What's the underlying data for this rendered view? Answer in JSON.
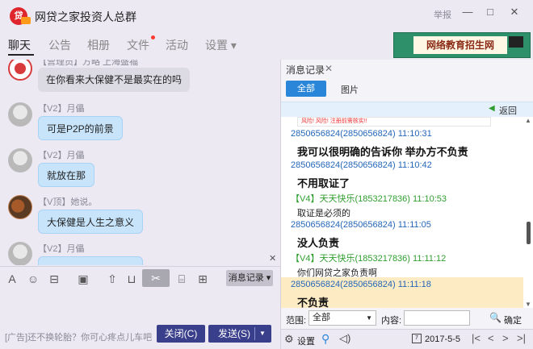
{
  "window": {
    "title": "网贷之家投资人总群",
    "logo_text": "贷",
    "report": "举报",
    "btn_minimize": "—",
    "btn_maximize": "□",
    "btn_close": "✕"
  },
  "tabs": [
    {
      "label": "聊天",
      "active": true
    },
    {
      "label": "公告"
    },
    {
      "label": "相册"
    },
    {
      "label": "文件",
      "has_dot": true
    },
    {
      "label": "活动"
    },
    {
      "label": "设置 ▾"
    }
  ],
  "banner": {
    "text": "网络教育招生网"
  },
  "chat": {
    "messages": [
      {
        "sender": "【营理员】方略 上海盛福",
        "text": "在你看来大保健不是最实在的吗",
        "style": "gray",
        "avatar": "red"
      },
      {
        "sender": "【V2】月儡",
        "text": "可是P2P的前景",
        "style": "blue",
        "avatar": "default"
      },
      {
        "sender": "【V2】月儡",
        "text": "就放在那",
        "style": "blue",
        "avatar": "default"
      },
      {
        "sender": "【V顶】她说。",
        "text": "大保健是人生之意义",
        "style": "blue",
        "avatar": "photo"
      },
      {
        "sender": "【V2】月儡",
        "text": "",
        "style": "blue",
        "avatar": "default"
      }
    ]
  },
  "toolbar": {
    "font_icon": "A",
    "emoji_icon": "☺",
    "gift_icon": "⊟",
    "image_icon": "▣",
    "upload_icon": "⇧",
    "folder_icon": "⊔",
    "scissors_icon": "✂",
    "history_icon": "⌸",
    "mail_icon": "⊞",
    "msg_record": "消息记录 ▾"
  },
  "input": {
    "ad_text": "[广告]还不换轮胎？你可心疼点儿车吧",
    "close_label": "关闭(C)",
    "send_label": "发送(S)",
    "send_arrow": "▼"
  },
  "panel": {
    "tab_label": "消息记录",
    "tab_close": "✕",
    "filter_all": "全部",
    "filter_images": "图片",
    "back": "返回",
    "image_strip": "风险! 风险! 注册前需核实!!",
    "records": [
      {
        "header": "2850656824(2850656824) 11:10:31",
        "header_style": "blue",
        "body": "我可以很明确的告诉你 举办方不负责",
        "body_style": "big"
      },
      {
        "header": "2850656824(2850656824) 11:10:42",
        "header_style": "blue",
        "body": "不用取证了",
        "body_style": "big"
      },
      {
        "header": "【V4】天天快乐(1853217836) 11:10:53",
        "header_style": "green",
        "body": "取证是必须的",
        "body_style": "small"
      },
      {
        "header": "2850656824(2850656824) 11:11:05",
        "header_style": "blue",
        "body": "没人负责",
        "body_style": "big"
      },
      {
        "header": "【V4】天天快乐(1853217836) 11:11:12",
        "header_style": "green",
        "body": "你们网贷之家负责啊",
        "body_style": "small"
      },
      {
        "header": "2850656824(2850656824) 11:11:18",
        "header_style": "blue",
        "body": "不负责",
        "body_style": "big"
      }
    ],
    "range_label": "范围:",
    "range_value": "全部",
    "content_label": "内容:",
    "confirm": "确定",
    "settings": "设置",
    "date": "2017-5-5",
    "nav_first": "|<",
    "nav_prev": "<",
    "nav_next": ">",
    "nav_last": ">|"
  }
}
